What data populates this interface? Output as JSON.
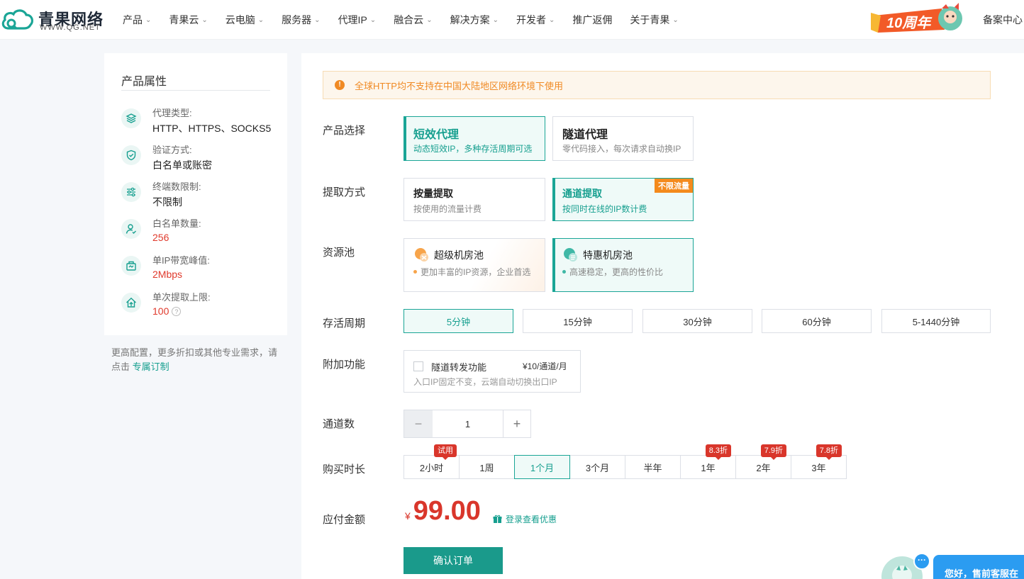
{
  "header": {
    "logo_name": "青果网络",
    "logo_sub": "WWW.QG.NET",
    "nav": [
      "产品",
      "青果云",
      "云电脑",
      "服务器",
      "代理IP",
      "融合云",
      "解决方案",
      "开发者",
      "推广返佣",
      "关于青果"
    ],
    "nav_has_menu": [
      true,
      true,
      true,
      true,
      true,
      true,
      true,
      true,
      false,
      true
    ],
    "anniversary": "10周年",
    "record_center": "备案中心"
  },
  "sidebar": {
    "title": "产品属性",
    "attributes": [
      {
        "label": "代理类型:",
        "value": "HTTP、HTTPS、SOCKS5",
        "icon": "layers-icon"
      },
      {
        "label": "验证方式:",
        "value": "白名单或账密",
        "icon": "shield-check-icon"
      },
      {
        "label": "终端数限制:",
        "value": "不限制",
        "icon": "sliders-icon"
      },
      {
        "label": "白名单数量:",
        "value": "256",
        "icon": "user-check-icon"
      },
      {
        "label": "单IP带宽峰值:",
        "value": "2Mbps",
        "icon": "bandwidth-icon"
      },
      {
        "label": "单次提取上限:",
        "value": "100",
        "icon": "upload-home-icon"
      }
    ],
    "note_text": "更高配置，更多折扣或其他专业需求，请点击",
    "note_link": "专属订制"
  },
  "main": {
    "notice": "全球HTTP均不支持在中国大陆地区网络环境下使用",
    "product": {
      "label": "产品选择",
      "options": [
        {
          "title": "短效代理",
          "desc": "动态短效IP，多种存活周期可选"
        },
        {
          "title": "隧道代理",
          "desc": "零代码接入，每次请求自动换IP"
        }
      ]
    },
    "extract": {
      "label": "提取方式",
      "options": [
        {
          "title": "按量提取",
          "desc": "按使用的流量计费"
        },
        {
          "title": "通道提取",
          "desc": "按同时在线的IP数计费",
          "tag": "不限流量"
        }
      ]
    },
    "pool": {
      "label": "资源池",
      "options": [
        {
          "title": "超级机房池",
          "desc": "更加丰富的IP资源，企业首选"
        },
        {
          "title": "特惠机房池",
          "desc": "高速稳定，更高的性价比"
        }
      ]
    },
    "lifetime": {
      "label": "存活周期",
      "options": [
        "5分钟",
        "15分钟",
        "30分钟",
        "60分钟",
        "5-1440分钟"
      ]
    },
    "addon": {
      "label": "附加功能",
      "name": "隧道转发功能",
      "price": "¥10/通道/月",
      "desc": "入口IP固定不变，云端自动切换出口IP"
    },
    "channels": {
      "label": "通道数",
      "minus": "−",
      "value": "1",
      "plus": "+"
    },
    "duration": {
      "label": "购买时长",
      "options": [
        {
          "label": "2小时",
          "badge": "试用"
        },
        {
          "label": "1周",
          "badge": ""
        },
        {
          "label": "1个月",
          "badge": ""
        },
        {
          "label": "3个月",
          "badge": ""
        },
        {
          "label": "半年",
          "badge": ""
        },
        {
          "label": "1年",
          "badge": "8.3折"
        },
        {
          "label": "2年",
          "badge": "7.9折"
        },
        {
          "label": "3年",
          "badge": "7.8折"
        }
      ]
    },
    "payment": {
      "label": "应付金额",
      "currency": "¥",
      "amount": "99.00",
      "coupon": "登录查看优惠"
    },
    "confirm": "确认订单"
  },
  "support": {
    "text": "您好，售前客服在",
    "bubble": "···"
  },
  "colors": {
    "accent": "#1aa596",
    "price": "#d9362b",
    "warning": "#f08a24",
    "support": "#2b9cf1"
  }
}
